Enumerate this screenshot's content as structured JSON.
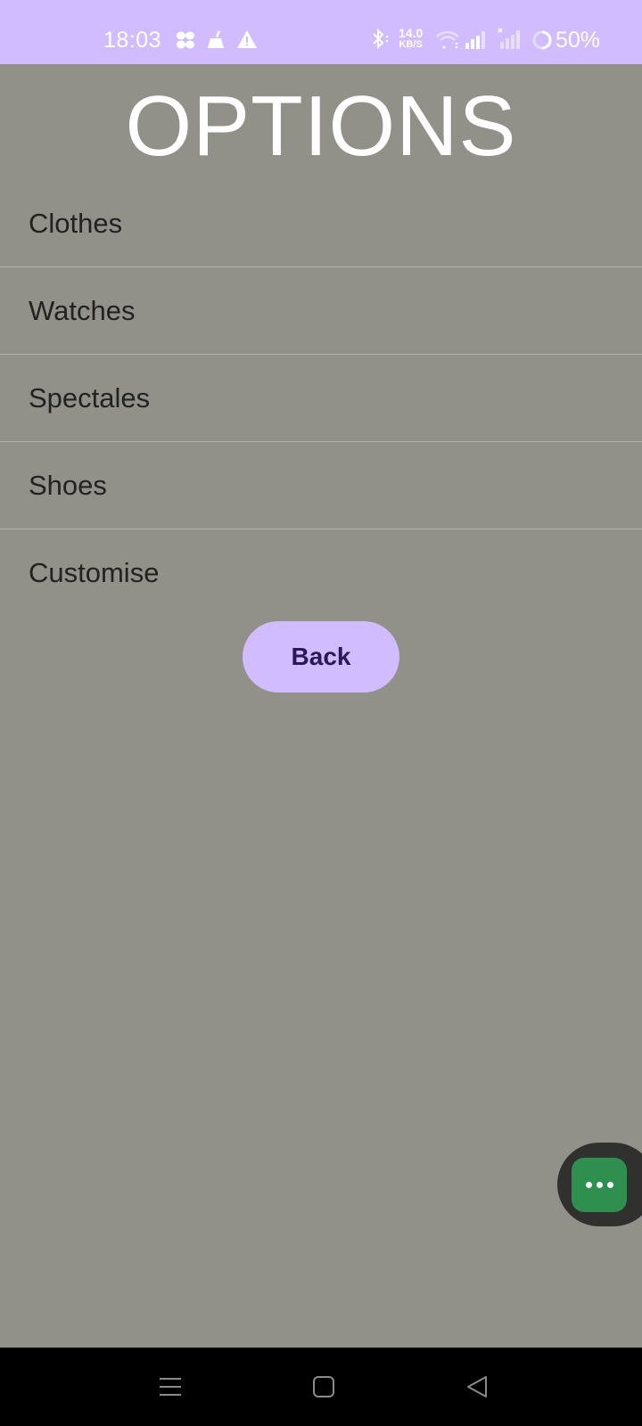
{
  "status_bar": {
    "time": "18:03",
    "net_speed_value": "14.0",
    "net_speed_unit": "KB/S",
    "battery": "50%",
    "icons": [
      "fan-icon",
      "cleaner-icon",
      "warning-icon",
      "bluetooth-icon",
      "wifi-icon",
      "signal-icon",
      "signal-no-service-icon",
      "battery-ring-icon"
    ]
  },
  "page": {
    "title": "OPTIONS"
  },
  "options": [
    {
      "label": "Clothes"
    },
    {
      "label": "Watches"
    },
    {
      "label": "Spectales"
    },
    {
      "label": "Shoes"
    },
    {
      "label": "Customise"
    }
  ],
  "back_button": {
    "label": "Back"
  },
  "floating_bubble": {
    "icon": "more-dots-icon"
  },
  "nav_bar": {
    "icons": [
      "menu-icon",
      "home-icon",
      "back-icon"
    ]
  },
  "colors": {
    "accent": "#d0bcff",
    "background": "#91918a",
    "button_text": "#2a1858",
    "bubble_green": "#2f8f4e"
  }
}
